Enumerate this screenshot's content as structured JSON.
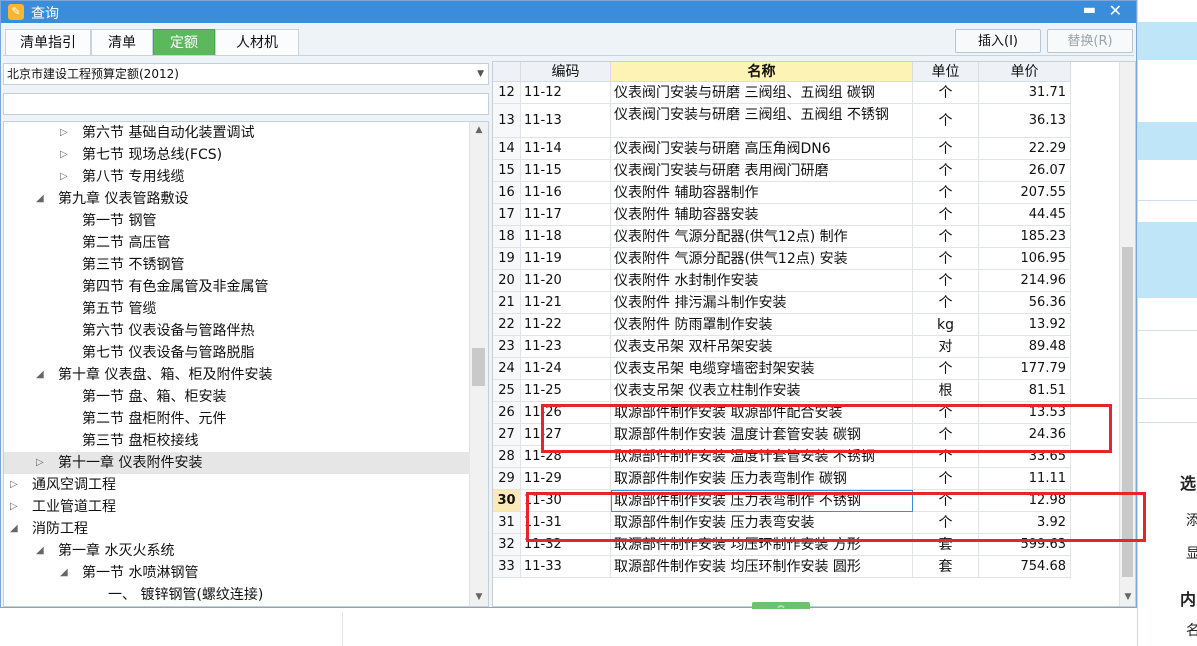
{
  "window": {
    "title": "查询",
    "min_glyph": "▬",
    "close_glyph": "✕"
  },
  "tabs": [
    {
      "label": "清单指引",
      "active": false
    },
    {
      "label": "清单",
      "active": false
    },
    {
      "label": "定额",
      "active": true
    },
    {
      "label": "人材机",
      "active": false
    }
  ],
  "buttons": {
    "insert": "插入(I)",
    "replace": "替换(R)"
  },
  "quota_select": {
    "value": "北京市建设工程预算定额(2012)"
  },
  "tree": [
    {
      "label": "第六节 基础自动化装置调试",
      "level": 2,
      "expander": "▷"
    },
    {
      "label": "第七节 现场总线(FCS)",
      "level": 2,
      "expander": "▷"
    },
    {
      "label": "第八节 专用线缆",
      "level": 2,
      "expander": "▷"
    },
    {
      "label": "第九章 仪表管路敷设",
      "level": 1,
      "expander": "◢"
    },
    {
      "label": "第一节 钢管",
      "level": 2,
      "expander": ""
    },
    {
      "label": "第二节 高压管",
      "level": 2,
      "expander": ""
    },
    {
      "label": "第三节 不锈钢管",
      "level": 2,
      "expander": ""
    },
    {
      "label": "第四节 有色金属管及非金属管",
      "level": 2,
      "expander": ""
    },
    {
      "label": "第五节 管缆",
      "level": 2,
      "expander": ""
    },
    {
      "label": "第六节 仪表设备与管路伴热",
      "level": 2,
      "expander": ""
    },
    {
      "label": "第七节 仪表设备与管路脱脂",
      "level": 2,
      "expander": ""
    },
    {
      "label": "第十章 仪表盘、箱、柜及附件安装",
      "level": 1,
      "expander": "◢"
    },
    {
      "label": "第一节 盘、箱、柜安装",
      "level": 2,
      "expander": ""
    },
    {
      "label": "第二节 盘柜附件、元件",
      "level": 2,
      "expander": ""
    },
    {
      "label": "第三节 盘柜校接线",
      "level": 2,
      "expander": ""
    },
    {
      "label": "第十一章 仪表附件安装",
      "level": 1,
      "expander": "▷",
      "selected": true
    },
    {
      "label": "通风空调工程",
      "level": 0,
      "expander": "▷"
    },
    {
      "label": "工业管道工程",
      "level": 0,
      "expander": "▷"
    },
    {
      "label": "消防工程",
      "level": 0,
      "expander": "◢"
    },
    {
      "label": "第一章 水灭火系统",
      "level": 1,
      "expander": "◢"
    },
    {
      "label": "第一节 水喷淋钢管",
      "level": 2,
      "expander": "◢"
    },
    {
      "label": "一、 镀锌钢管(螺纹连接)",
      "level": 3,
      "expander": ""
    }
  ],
  "grid": {
    "headers": {
      "code": "编码",
      "name": "名称",
      "unit": "单位",
      "price": "单价"
    },
    "rows": [
      {
        "n": "12",
        "code": "11-12",
        "name": "仪表阀门安装与研磨 三阀组、五阀组 碳钢",
        "unit": "个",
        "price": "31.71"
      },
      {
        "n": "13",
        "code": "11-13",
        "name": "仪表阀门安装与研磨 三阀组、五阀组 不锈钢",
        "unit": "个",
        "price": "36.13",
        "tall": true
      },
      {
        "n": "14",
        "code": "11-14",
        "name": "仪表阀门安装与研磨 高压角阀DN6",
        "unit": "个",
        "price": "22.29"
      },
      {
        "n": "15",
        "code": "11-15",
        "name": "仪表阀门安装与研磨 表用阀门研磨",
        "unit": "个",
        "price": "26.07"
      },
      {
        "n": "16",
        "code": "11-16",
        "name": "仪表附件 辅助容器制作",
        "unit": "个",
        "price": "207.55"
      },
      {
        "n": "17",
        "code": "11-17",
        "name": "仪表附件 辅助容器安装",
        "unit": "个",
        "price": "44.45"
      },
      {
        "n": "18",
        "code": "11-18",
        "name": "仪表附件 气源分配器(供气12点) 制作",
        "unit": "个",
        "price": "185.23"
      },
      {
        "n": "19",
        "code": "11-19",
        "name": "仪表附件 气源分配器(供气12点) 安装",
        "unit": "个",
        "price": "106.95"
      },
      {
        "n": "20",
        "code": "11-20",
        "name": "仪表附件 水封制作安装",
        "unit": "个",
        "price": "214.96"
      },
      {
        "n": "21",
        "code": "11-21",
        "name": "仪表附件 排污漏斗制作安装",
        "unit": "个",
        "price": "56.36"
      },
      {
        "n": "22",
        "code": "11-22",
        "name": "仪表附件 防雨罩制作安装",
        "unit": "kg",
        "price": "13.92"
      },
      {
        "n": "23",
        "code": "11-23",
        "name": "仪表支吊架 双杆吊架安装",
        "unit": "对",
        "price": "89.48"
      },
      {
        "n": "24",
        "code": "11-24",
        "name": "仪表支吊架 电缆穿墙密封架安装",
        "unit": "个",
        "price": "177.79"
      },
      {
        "n": "25",
        "code": "11-25",
        "name": "仪表支吊架 仪表立柱制作安装",
        "unit": "根",
        "price": "81.51"
      },
      {
        "n": "26",
        "code": "11-26",
        "name": "取源部件制作安装 取源部件配合安装",
        "unit": "个",
        "price": "13.53"
      },
      {
        "n": "27",
        "code": "11-27",
        "name": "取源部件制作安装 温度计套管安装 碳钢",
        "unit": "个",
        "price": "24.36"
      },
      {
        "n": "28",
        "code": "11-28",
        "name": "取源部件制作安装 温度计套管安装 不锈钢",
        "unit": "个",
        "price": "33.65"
      },
      {
        "n": "29",
        "code": "11-29",
        "name": "取源部件制作安装 压力表弯制作 碳钢",
        "unit": "个",
        "price": "11.11"
      },
      {
        "n": "30",
        "code": "11-30",
        "name": "取源部件制作安装 压力表弯制作 不锈钢",
        "unit": "个",
        "price": "12.98",
        "current": true
      },
      {
        "n": "31",
        "code": "11-31",
        "name": "取源部件制作安装 压力表弯安装",
        "unit": "个",
        "price": "3.92"
      },
      {
        "n": "32",
        "code": "11-32",
        "name": "取源部件制作安装 均压环制作安装 方形",
        "unit": "套",
        "price": "599.63"
      },
      {
        "n": "33",
        "code": "11-33",
        "name": "取源部件制作安装 均压环制作安装 圆形",
        "unit": "套",
        "price": "754.68"
      }
    ]
  },
  "background": {
    "fragments": [
      "选",
      "添",
      "显",
      "内",
      "名"
    ]
  },
  "colors": {
    "title_bar": "#3a8ddb",
    "active_tab": "#5cb85c",
    "header_highlight": "#fdf3b4",
    "annotation_red": "#e8242b"
  },
  "icons": {
    "app": "app-logo-icon",
    "minimize": "minimize-icon",
    "close": "close-icon",
    "dropdown": "chevron-down-icon"
  }
}
